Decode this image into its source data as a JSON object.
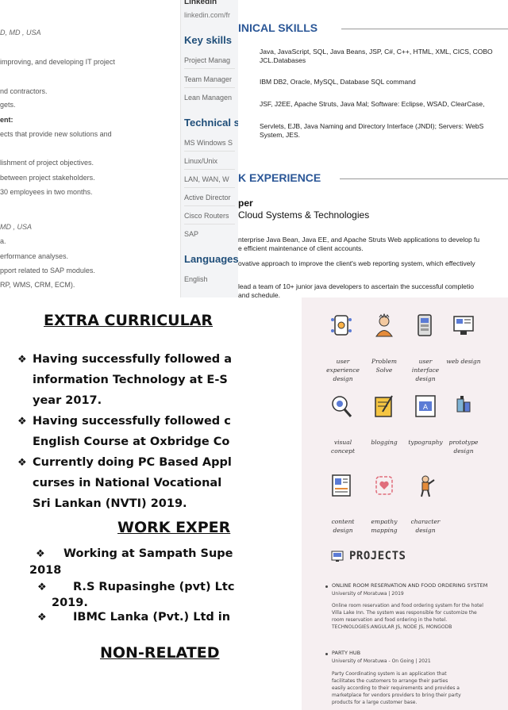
{
  "resume_left": {
    "lines": [
      {
        "text": "D, MD , USA",
        "italic": true
      },
      {
        "text": "improving, and developing IT project",
        "italic": false
      },
      {
        "text": "nd contractors.",
        "italic": false
      },
      {
        "text": "gets.",
        "italic": false
      },
      {
        "text": "ent:",
        "italic": false,
        "bold": true
      },
      {
        "text": "ects that provide new solutions and",
        "italic": false
      },
      {
        "text": "lishment of project objectives.",
        "italic": false
      },
      {
        "text": "between project stakeholders.",
        "italic": false
      },
      {
        "text": "30 employees in two months.",
        "italic": false
      },
      {
        "text": "MD , USA",
        "italic": true
      },
      {
        "text": "a.",
        "italic": false
      },
      {
        "text": "erformance analyses.",
        "italic": false
      },
      {
        "text": "pport related to SAP modules.",
        "italic": false
      },
      {
        "text": "RP, WMS, CRM, ECM).",
        "italic": false
      }
    ]
  },
  "sidebar": {
    "linkedin_label": "Linkedin",
    "linkedin_url": "linkedin.com/fr",
    "key_skills_title": "Key skills",
    "key_skills": [
      "Project Manag",
      "Team Manager",
      "Lean Managen"
    ],
    "technical_title": "Technical s",
    "technical": [
      "MS Windows S",
      "Linux/Unix",
      "LAN, WAN, W",
      "Active Director",
      "Cisco Routers",
      "SAP"
    ],
    "languages_title": "Languages",
    "languages": [
      "English"
    ]
  },
  "tech": {
    "skills_heading": "INICAL SKILLS",
    "skills": [
      [
        "Java, JavaScript, SQL, Java Beans, JSP, C#, C++, HTML, XML, CICS, COBO",
        "JCL.Databases"
      ],
      [
        "IBM DB2, Oracle, MySQL, Database SQL command"
      ],
      [
        "JSF, J2EE, Apache Struts, Java Mal; Software: Eclipse, WSAD, ClearCase,"
      ],
      [
        "Servlets, EJB, Java Naming and Directory Interface (JNDI); Servers: WebS",
        "System, JES."
      ]
    ],
    "experience_heading": "K EXPERIENCE",
    "role": "per",
    "company": "Cloud Systems & Technologies",
    "descriptions": [
      "nterprise Java Bean, Java EE, and Apache Struts Web applications to develop fu",
      "e efficient maintenance of client accounts.",
      "ovative approach to improve the client's web reporting system, which effectively",
      "lead a team of 10+ junior java developers to ascertain the successful completio",
      "and schedule."
    ]
  },
  "extra": {
    "heading": "EXTRA CURRICULAR",
    "bullets": [
      [
        "Having successfully followed a",
        "information Technology at E-S",
        "year 2017."
      ],
      [
        "Having successfully followed c",
        "English Course at Oxbridge Co"
      ],
      [
        "Currently doing PC Based Appl",
        "curses in National  Vocational",
        "Sri Lankan (NVTI) 2019."
      ]
    ],
    "work_heading": "WORK EXPER",
    "work": [
      [
        "Working at Sampath Supe",
        "2018"
      ],
      [
        "R.S Rupasinghe (pvt) Ltc",
        "2019."
      ],
      [
        "IBMC Lanka (Pvt.) Ltd in"
      ]
    ],
    "nonrelated_heading": "NON-RELATED"
  },
  "portfolio": {
    "skills": [
      {
        "label": "user experience design",
        "icon": "ux-icon"
      },
      {
        "label": "Problem Solve",
        "icon": "problem-solve-icon"
      },
      {
        "label": "user interface design",
        "icon": "ui-icon"
      },
      {
        "label": "web design",
        "icon": "web-design-icon"
      },
      {
        "label": "visual concept",
        "icon": "visual-concept-icon"
      },
      {
        "label": "blogging",
        "icon": "blogging-icon"
      },
      {
        "label": "typography",
        "icon": "typography-icon"
      },
      {
        "label": "prototype design",
        "icon": "prototype-icon"
      },
      {
        "label": "content design",
        "icon": "content-design-icon"
      },
      {
        "label": "empathy mapping",
        "icon": "empathy-icon"
      },
      {
        "label": "character design",
        "icon": "character-icon"
      }
    ],
    "projects_heading": "PROJECTS",
    "projects": [
      {
        "title": "ONLINE ROOM RESERVATION AND FOOD ORDERING SYSTEM",
        "sub": "University of Moratuwa | 2019",
        "desc": [
          "Online room reservation and food ordering system for the hotel",
          "Villa Lake Inn. The system was responsible for customize the",
          "room reservation and food ordering in the hotel.",
          "TECHNOLOGIES:ANGULAR JS, NODE JS, MONGODB"
        ]
      },
      {
        "title": "PARTY HUB",
        "sub": "University of Moratuwa - On Going | 2021",
        "desc": [
          "Party Coordinating system is an application that",
          "facilitates the customers to arrange their parties",
          "easily according to their requirements and provides a",
          "marketplace for vendors providers to bring their party",
          "products for a large customer base."
        ]
      }
    ],
    "accent": "#5b7bd5"
  }
}
